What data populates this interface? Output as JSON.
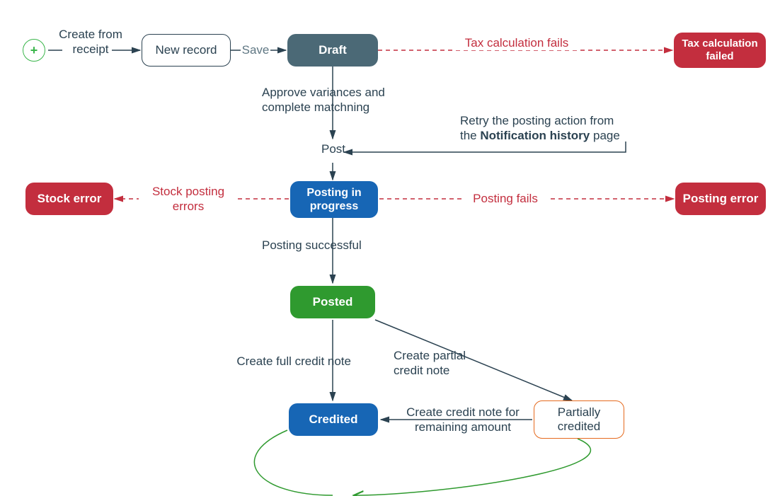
{
  "nodes": {
    "plus": "+",
    "new_record": "New record",
    "draft": "Draft",
    "tax_fail": "Tax calculation failed",
    "posting_progress": "Posting in progress",
    "stock_error": "Stock error",
    "posting_error": "Posting error",
    "posted": "Posted",
    "credited": "Credited",
    "partially_credited": "Partially credited"
  },
  "labels": {
    "create_from_receipt": "Create from receipt",
    "save": "Save",
    "tax_calc_fails": "Tax calculation fails",
    "approve_variances": "Approve variances and complete matchning",
    "post": "Post",
    "retry_line1": "Retry the posting action from",
    "retry_line2_pre": "the ",
    "retry_line2_bold": "Notification history",
    "retry_line2_post": " page",
    "stock_posting_errors": "Stock posting errors",
    "posting_fails": "Posting fails",
    "posting_successful": "Posting successful",
    "create_full_credit": "Create full credit note",
    "create_partial_credit": "Create partial credit note",
    "create_remaining": "Create credit note for remaining amount"
  },
  "colors": {
    "slate": "#4b6976",
    "blue": "#1766b5",
    "green": "#2f9a2f",
    "red": "#c32e3e",
    "orange": "#e56a1e",
    "text": "#2b4251",
    "plus": "#39b54a"
  }
}
